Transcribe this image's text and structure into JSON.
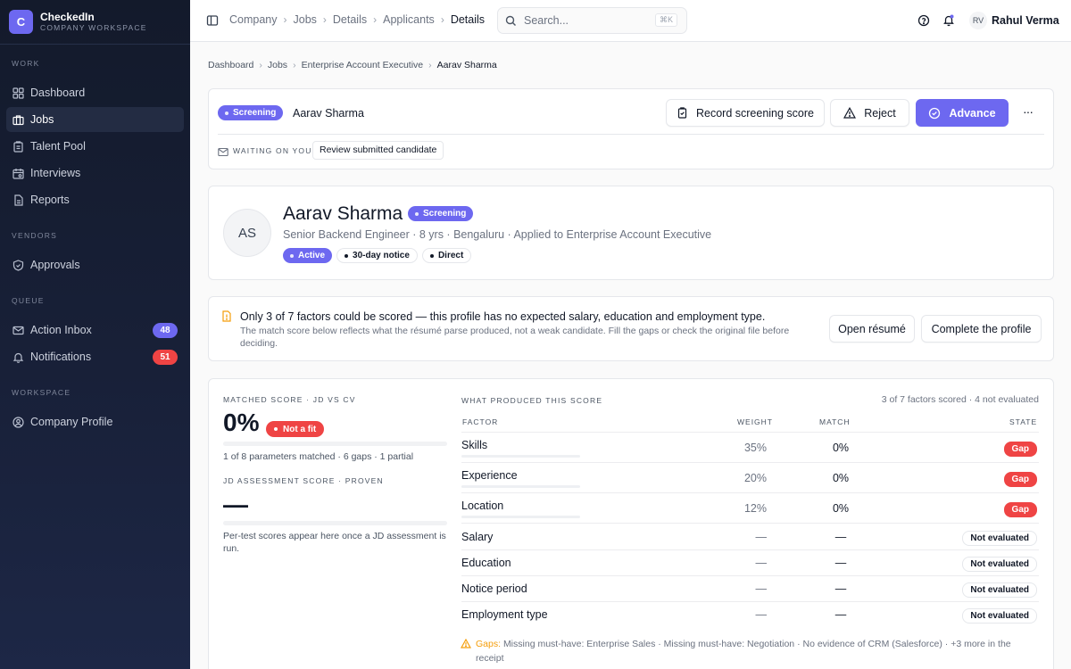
{
  "app": {
    "logo_letter": "C",
    "name": "CheckedIn",
    "subtitle": "COMPANY WORKSPACE",
    "accent_color": "#6d68f0"
  },
  "sidebar": {
    "sections": [
      {
        "label": "WORK",
        "items": [
          {
            "label": "Dashboard",
            "icon": "grid-icon"
          },
          {
            "label": "Jobs",
            "icon": "briefcase-icon",
            "active": true
          },
          {
            "label": "Talent Pool",
            "icon": "clipboard-icon"
          },
          {
            "label": "Interviews",
            "icon": "calendar-icon"
          },
          {
            "label": "Reports",
            "icon": "file-icon"
          }
        ]
      },
      {
        "label": "VENDORS",
        "items": [
          {
            "label": "Approvals",
            "icon": "shield-check-icon"
          }
        ]
      },
      {
        "label": "QUEUE",
        "items": [
          {
            "label": "Action Inbox",
            "icon": "inbox-icon",
            "badge": "48",
            "badge_color": "#6d68f0"
          },
          {
            "label": "Notifications",
            "icon": "bell-icon",
            "badge": "51",
            "badge_color": "#ef4444"
          }
        ]
      },
      {
        "label": "WORKSPACE",
        "items": [
          {
            "label": "Company Profile",
            "icon": "user-circle-icon"
          }
        ]
      }
    ]
  },
  "topbar": {
    "breadcrumbs": [
      "Company",
      "Jobs",
      "Details",
      "Applicants",
      "Details"
    ],
    "search_placeholder": "Search...",
    "search_shortcut": "⌘K",
    "user_initials": "RV",
    "user_name": "Rahul Verma"
  },
  "breadcrumb": [
    "Dashboard",
    "Jobs",
    "Enterprise Account Executive",
    "Aarav Sharma"
  ],
  "action_bar": {
    "stage": "Screening",
    "candidate": "Aarav Sharma",
    "record_label": "Record screening score",
    "reject_label": "Reject",
    "advance_label": "Advance",
    "waiting_label": "WAITING ON YOU",
    "waiting_task": "Review submitted candidate"
  },
  "profile": {
    "initials": "AS",
    "name": "Aarav Sharma",
    "stage": "Screening",
    "subtitle": "Senior Backend Engineer · 8 yrs · Bengaluru · Applied to Enterprise Account Executive",
    "tags": {
      "status": "Active",
      "notice": "30-day notice",
      "source": "Direct"
    }
  },
  "alert": {
    "title": "Only 3 of 7 factors could be scored — this profile has no expected salary, education and employment type.",
    "body": "The match score below reflects what the résumé parse produced, not a weak candidate. Fill the gaps or check the original file before deciding.",
    "open_resume": "Open résumé",
    "complete_profile": "Complete the profile",
    "color": "#f59e0b"
  },
  "score": {
    "label": "MATCHED SCORE · JD VS CV",
    "value": "0%",
    "fit_badge": "Not a fit",
    "match_fraction": 0,
    "summary": "1 of 8 parameters matched · 6 gaps · 1 partial",
    "assessment_label": "JD ASSESSMENT SCORE · PROVEN",
    "assessment_value": "—",
    "assessment_fraction": 0,
    "assessment_note": "Per-test scores appear here once a JD assessment is run."
  },
  "factors": {
    "title": "WHAT PRODUCED THIS SCORE",
    "summary": "3 of 7 factors scored · 4 not evaluated",
    "headers": {
      "factor": "FACTOR",
      "weight": "WEIGHT",
      "match": "MATCH",
      "state": "STATE"
    },
    "rows": [
      {
        "name": "Skills",
        "weight": "35%",
        "match": "0%",
        "state": "Gap",
        "scored": true
      },
      {
        "name": "Experience",
        "weight": "20%",
        "match": "0%",
        "state": "Gap",
        "scored": true
      },
      {
        "name": "Location",
        "weight": "12%",
        "match": "0%",
        "state": "Gap",
        "scored": true
      },
      {
        "name": "Salary",
        "weight": "—",
        "match": "—",
        "state": "Not evaluated",
        "scored": false
      },
      {
        "name": "Education",
        "weight": "—",
        "match": "—",
        "state": "Not evaluated",
        "scored": false
      },
      {
        "name": "Notice period",
        "weight": "—",
        "match": "—",
        "state": "Not evaluated",
        "scored": false
      },
      {
        "name": "Employment type",
        "weight": "—",
        "match": "—",
        "state": "Not evaluated",
        "scored": false
      }
    ],
    "gaps_label": "Gaps:",
    "gaps_text": "Missing must-have: Enterprise Sales · Missing must-have: Negotiation · No evidence of CRM (Salesforce) · +3 more in the receipt"
  }
}
